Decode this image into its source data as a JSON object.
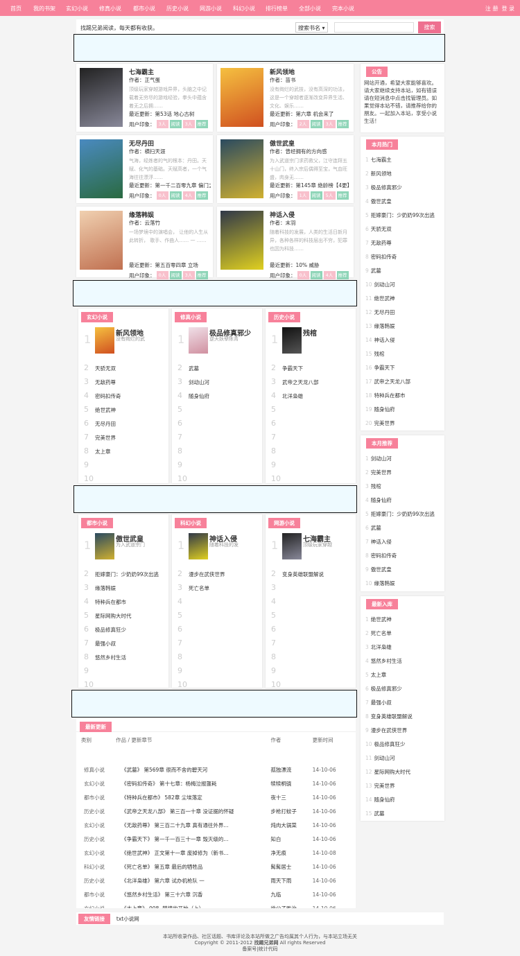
{
  "nav": {
    "items": [
      "首页",
      "我的书架",
      "玄幻小说",
      "修真小说",
      "都市小说",
      "历史小说",
      "网游小说",
      "科幻小说",
      "排行榜单",
      "全部小说",
      "完本小说"
    ],
    "register": "注 册",
    "login": "登 录"
  },
  "search": {
    "slogan": "找踢兄弟阅读，每天都有收获。",
    "select": "搜索书名",
    "value": "",
    "button": "搜索"
  },
  "colors": {
    "accent": "#f7819a",
    "ad_bg": "#eefaff"
  },
  "featured": [
    {
      "title": "七海霸主",
      "author": "作者：正气蛋",
      "desc": "顶级玩家穿越游戏异界，头脑之中记载着无穷尽的游戏经验，拳头中蕴含着无之后拥……",
      "update": "最近更新：第53话 地心古树",
      "impression": "用户印象：",
      "b1": "3人",
      "read": "阅读",
      "b2": "3人",
      "rec": "推荐",
      "cover": [
        "#222",
        "#889"
      ]
    },
    {
      "title": "新风领地",
      "author": "作者：苗书",
      "desc": "没有绚烂的武技，没有高深的功法，这是一个穿越者逐渐改变异界生活、文化、娱乐……",
      "update": "最近更新：第六章 机会来了",
      "impression": "用户印象：",
      "b1": "2人",
      "read": "阅读",
      "b2": "3人",
      "rec": "推荐",
      "cover": [
        "#f5c040",
        "#d05020"
      ]
    },
    {
      "title": "无尽丹田",
      "author": "作者：横扫天涯",
      "desc": "气海，经炼者的气的根本：丹田。天赋、化气的基础。天赋高者，一个气海往往漂浮……",
      "update": "最近更新：第一千二百零九章 偏门之",
      "impression": "用户印象：",
      "b1": "0人",
      "read": "阅读",
      "b2": "4人",
      "rec": "推荐",
      "cover": [
        "#4a8ac0",
        "#2a6a40"
      ]
    },
    {
      "title": "傲世武皇",
      "author": "作者：曾经拥有的方向感",
      "desc": "为入武道宗门求药救父，江守连拜五十山门，终入宗后偶得至宝，气血旺盛，肉身无……",
      "update": "最近更新：第145章 绝龄榜【4更】",
      "impression": "用户印象：",
      "b1": "1人",
      "read": "阅读",
      "b2": "5人",
      "rec": "推荐",
      "cover": [
        "#2a4a60",
        "#d0b030"
      ]
    },
    {
      "title": "缘落韩娱",
      "author": "作者：云落竹",
      "desc": "一场梦境中的演唱会， 让他的人生从此转折， 歌手、作曲人…… 一 ……",
      "update": "最近更新：第五百零四章 立场",
      "impression": "用户印象：",
      "b1": "0人",
      "read": "阅读",
      "b2": "3人",
      "rec": "推荐",
      "cover": [
        "#f0d0b0",
        "#c07050"
      ]
    },
    {
      "title": "神话入侵",
      "author": "作者：末羽",
      "desc": "随着科技的发展，人类的生活日新月异，各种各样的科技层出不穷，犯罪也因为科技……",
      "update": "最近更新：10% 威胁",
      "impression": "用户印象：",
      "b1": "0人",
      "read": "阅读",
      "b2": "4人",
      "rec": "推荐",
      "cover": [
        "#303848",
        "#e0d020"
      ]
    }
  ],
  "genres": [
    {
      "tag": "玄幻小说",
      "top": {
        "title": "新风领地",
        "sub": "没有绚烂的武",
        "cover": [
          "#f5c040",
          "#d05020"
        ]
      },
      "items": [
        "天骄无双",
        "无敌药尊",
        "密码扣传奇",
        "绝世武神",
        "无尽丹田",
        "完美世界",
        "太上章",
        "",
        ""
      ]
    },
    {
      "tag": "修真小说",
      "top": {
        "title": "极品修真邪少",
        "sub": "逆天妖孽陈青",
        "cover": [
          "#f0e0e8",
          "#d090a0"
        ]
      },
      "items": [
        "武墓",
        "剑动山河",
        "随身仙府",
        "",
        "",
        "",
        "",
        "",
        ""
      ]
    },
    {
      "tag": "历史小说",
      "top": {
        "title": "残棺",
        "sub": "",
        "cover": [
          "#111",
          "#555"
        ]
      },
      "items": [
        "争霸天下",
        "武帝之天龙八部",
        "北洋枭雄",
        "",
        "",
        "",
        "",
        "",
        ""
      ]
    },
    {
      "tag": "都市小说",
      "top": {
        "title": "傲世武皇",
        "sub": "为入武道宗门",
        "cover": [
          "#2a4a60",
          "#d0b030"
        ]
      },
      "items": [
        "拒嫁豪门：少奶奶99次出逃",
        "缘落韩娱",
        "特种兵在都市",
        "星际网购大时代",
        "极品修真狂少",
        "最强小叔",
        "悠然乡村生活",
        "",
        ""
      ]
    },
    {
      "tag": "科幻小说",
      "top": {
        "title": "神话入侵",
        "sub": "随着科技的发",
        "cover": [
          "#303848",
          "#e0d020"
        ]
      },
      "items": [
        "漫步在武侠世界",
        "死亡名单",
        "",
        "",
        "",
        "",
        "",
        "",
        ""
      ]
    },
    {
      "tag": "网游小说",
      "top": {
        "title": "七海霸主",
        "sub": "顶级玩家穿越",
        "cover": [
          "#222",
          "#889"
        ]
      },
      "items": [
        "变身英雄联盟解说",
        "",
        "",
        "",
        "",
        "",
        "",
        "",
        ""
      ]
    }
  ],
  "sidebar": {
    "notice": {
      "tag": "公告",
      "text": "网站开通，希望大家能够喜欢。请大家继续支持本站，如有错误请在短消息中点击找管理员。如果觉得本站不错，请推荐给你的朋友。一起加入本站，享受小说生活！"
    },
    "hot": {
      "tag": "本月热门",
      "items": [
        "七海霸主",
        "新风领地",
        "极品修真邪少",
        "傲世武皇",
        "拒嫁豪门：少奶奶99次出逃",
        "天骄无双",
        "无敌药尊",
        "密码扣传奇",
        "武墓",
        "剑动山河",
        "绝世武神",
        "无尽丹田",
        "缘落韩娱",
        "神话入侵",
        "残棺",
        "争霸天下",
        "武帝之天龙八部",
        "特种兵在都市",
        "随身仙府",
        "完美世界"
      ]
    },
    "recommend": {
      "tag": "本月推荐",
      "items": [
        "剑动山河",
        "完美世界",
        "残棺",
        "随身仙府",
        "拒嫁豪门：少奶奶99次出逃",
        "武墓",
        "神话入侵",
        "密码扣传奇",
        "傲世武皇",
        "缘落韩娱"
      ]
    },
    "newest": {
      "tag": "最新入库",
      "items": [
        "绝世武神",
        "死亡名单",
        "北洋枭雄",
        "悠然乡村生活",
        "太上章",
        "极品修真邪少",
        "最强小叔",
        "变身英雄联盟解说",
        "漫步在武侠世界",
        "极品修真狂少",
        "剑动山河",
        "星际网购大时代",
        "完美世界",
        "随身仙府",
        "武墓"
      ]
    }
  },
  "updates": {
    "tag": "最新更新",
    "headers": [
      "类别",
      "作品 / 更新章节",
      "作者",
      "更新时间"
    ],
    "rows": [
      [
        "修真小说",
        "《武墓》 第569章 很而不舍的碧天河",
        "孤独漂流",
        "14-10-06"
      ],
      [
        "玄幻小说",
        "《密码扣传奇》 第十七章：杨梅泣报噩耗",
        "犊犊桐骁",
        "14-10-06"
      ],
      [
        "都市小说",
        "《特种兵在都市》 582章 尘埃落定",
        "夜十三",
        "14-10-06"
      ],
      [
        "历史小说",
        "《武帝之天龙八部》 第三百一十章 没证据的怀疑",
        "步枪打蚊子",
        "14-10-06"
      ],
      [
        "玄幻小说",
        "《无敌药尊》 第三百二十九章 真有通往外界...",
        "炖肉大锅菜",
        "14-10-06"
      ],
      [
        "历史小说",
        "《争霸天下》 第一千一百三十一章 毁灭级的...",
        "知白",
        "14-10-06"
      ],
      [
        "玄幻小说",
        "《绝世武神》 正文第十一章 废掉修为（新书...",
        "净无痕",
        "14-10-08"
      ],
      [
        "科幻小说",
        "《死亡名单》 第五章 最后的牺牲品",
        "髯髯居士",
        "14-10-06"
      ],
      [
        "历史小说",
        "《北洋枭雄》 第六章 试办机枪队 一",
        "雨天下雨",
        "14-10-06"
      ],
      [
        "都市小说",
        "《悠然乡村生活》 第三十六章 沉香",
        "九临",
        "14-10-06"
      ],
      [
        "玄幻小说",
        "《太上章》 008. 梦境的开始（上）",
        "徐公子胜治",
        "14-10-06"
      ]
    ]
  },
  "links": {
    "tag": "友情链接",
    "items": [
      "txt小说网"
    ]
  },
  "footer": {
    "line1": "本站所收录作品、社区话题、书库评论及本站所做之广告均属其个人行为，与本站立场无关",
    "copyright": "Copyright © 2011-2012",
    "site": "找踢兄弟网",
    "rights": "All rights Reserved",
    "icp": "备案号|统计代码"
  }
}
